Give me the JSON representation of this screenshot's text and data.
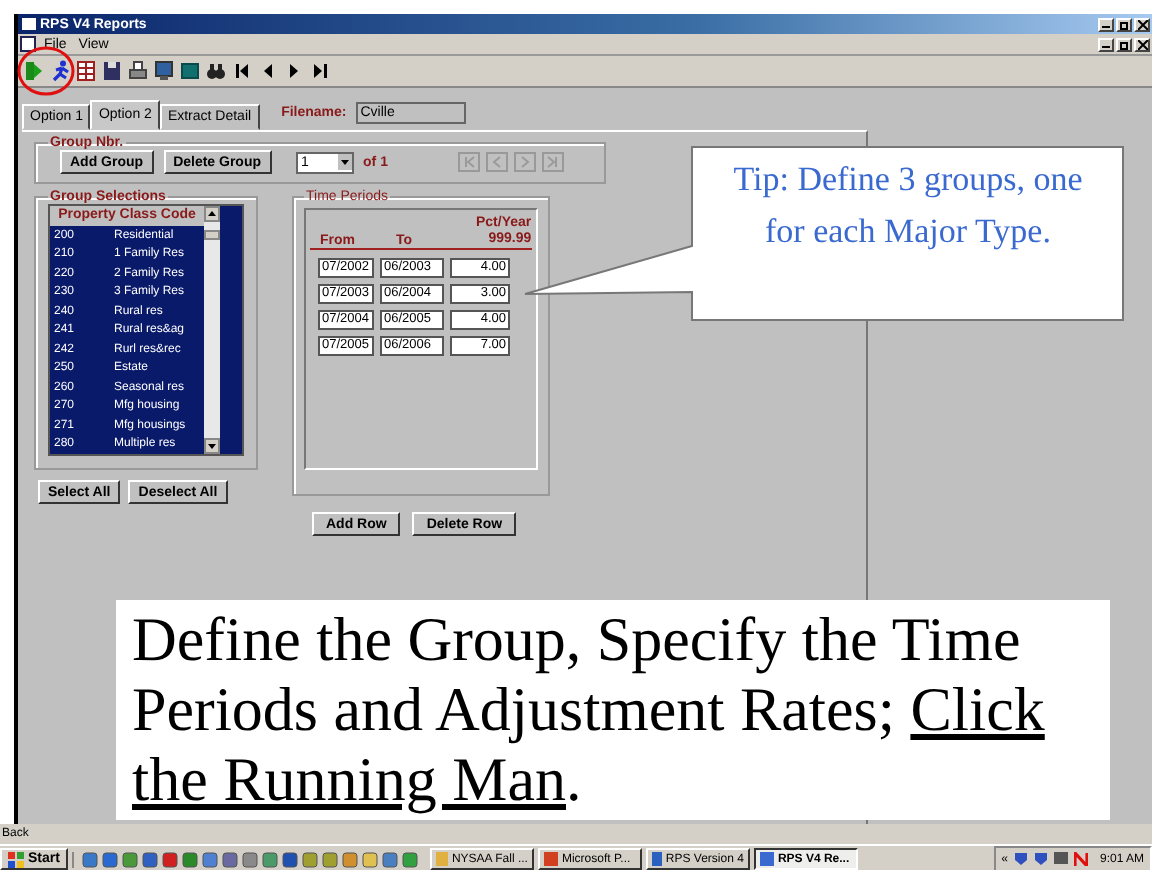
{
  "window": {
    "title": "RPS V4 Reports"
  },
  "menu": [
    "File",
    "View"
  ],
  "tabs": [
    {
      "label": "Option 1",
      "selected": false
    },
    {
      "label": "Option 2",
      "selected": true
    },
    {
      "label": "Extract Detail",
      "selected": false
    }
  ],
  "filename": {
    "label": "Filename:",
    "value": "Cville"
  },
  "group_nbr": {
    "title": "Group Nbr.",
    "buttons": [
      "Add Group",
      "Delete Group"
    ],
    "combo_value": "1",
    "of_label": "of 1"
  },
  "group_selections": {
    "title": "Group Selections",
    "column": "Property Class Code",
    "rows": [
      {
        "code": "200",
        "name": "Residential",
        "selected": true
      },
      {
        "code": "210",
        "name": "1 Family Res",
        "selected": true
      },
      {
        "code": "220",
        "name": "2 Family Res",
        "selected": true
      },
      {
        "code": "230",
        "name": "3 Family Res",
        "selected": true
      },
      {
        "code": "240",
        "name": "Rural res",
        "selected": true
      },
      {
        "code": "241",
        "name": "Rural res&ag",
        "selected": true
      },
      {
        "code": "242",
        "name": "Rurl res&rec",
        "selected": true
      },
      {
        "code": "250",
        "name": "Estate",
        "selected": true
      },
      {
        "code": "260",
        "name": "Seasonal res",
        "selected": true
      },
      {
        "code": "270",
        "name": "Mfg housing",
        "selected": true
      },
      {
        "code": "271",
        "name": "Mfg housings",
        "selected": true
      },
      {
        "code": "280",
        "name": "Multiple res",
        "selected": true
      }
    ],
    "buttons": [
      "Select All",
      "Deselect All"
    ]
  },
  "time_periods": {
    "title": "Time Periods",
    "columns": [
      {
        "label": "From"
      },
      {
        "label": "To"
      },
      {
        "label": "Pct/Year",
        "sublabel": "999.99"
      }
    ],
    "rows": [
      {
        "from": "07/2002",
        "to": "06/2003",
        "pct": "4.00"
      },
      {
        "from": "07/2003",
        "to": "06/2004",
        "pct": "3.00"
      },
      {
        "from": "07/2004",
        "to": "06/2005",
        "pct": "4.00"
      },
      {
        "from": "07/2005",
        "to": "06/2006",
        "pct": "7.00"
      }
    ],
    "buttons": [
      "Add Row",
      "Delete Row"
    ]
  },
  "tip": "Tip:  Define 3 groups, one for each Major Type.",
  "caption": {
    "text": "Define the Group, Specify the Time Periods and Adjustment Rates; ",
    "underlined": "Click the Running Man",
    "end": "."
  },
  "status_bar": "Back",
  "taskbar": {
    "start": "Start",
    "tasks": [
      {
        "label": "NYSAA Fall ...",
        "selected": false
      },
      {
        "label": "Microsoft P...",
        "selected": false
      },
      {
        "label": "RPS Version 4",
        "selected": false
      },
      {
        "label": "RPS V4 Re...",
        "selected": true
      }
    ],
    "tray_expand": "«",
    "clock": "9:01 AM"
  }
}
